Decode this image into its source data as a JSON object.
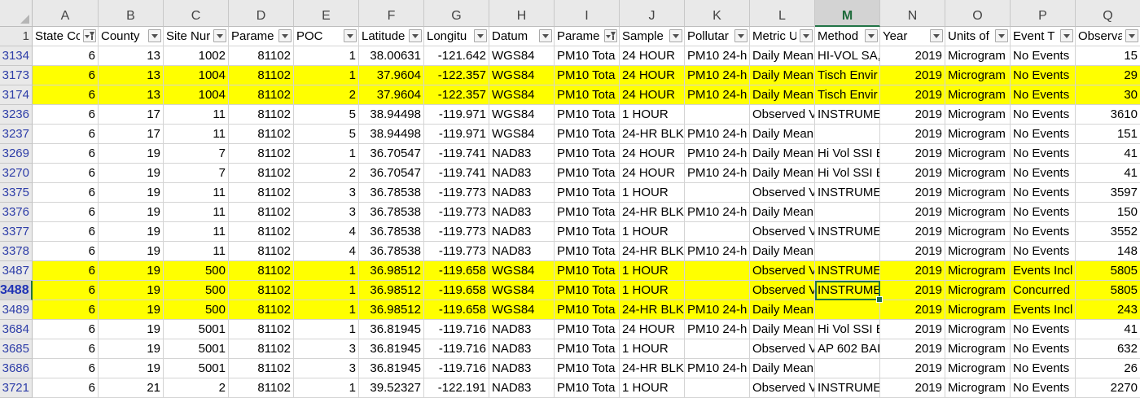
{
  "columns": [
    "A",
    "B",
    "C",
    "D",
    "E",
    "F",
    "G",
    "H",
    "I",
    "J",
    "K",
    "L",
    "M",
    "N",
    "O",
    "P",
    "Q"
  ],
  "selected_column": "M",
  "header_row_number": "1",
  "headers": [
    {
      "label": "State Co",
      "filter": "active"
    },
    {
      "label": "County",
      "filter": "dropdown"
    },
    {
      "label": "Site Nur",
      "filter": "dropdown"
    },
    {
      "label": "Parame",
      "filter": "dropdown"
    },
    {
      "label": "POC",
      "filter": "dropdown"
    },
    {
      "label": "Latitude",
      "filter": "dropdown"
    },
    {
      "label": "Longitu",
      "filter": "dropdown"
    },
    {
      "label": "Datum",
      "filter": "dropdown"
    },
    {
      "label": "Parame",
      "filter": "active"
    },
    {
      "label": "Sample",
      "filter": "dropdown"
    },
    {
      "label": "Pollutar",
      "filter": "dropdown"
    },
    {
      "label": "Metric U",
      "filter": "dropdown"
    },
    {
      "label": "Method",
      "filter": "dropdown"
    },
    {
      "label": "Year",
      "filter": "dropdown"
    },
    {
      "label": "Units of",
      "filter": "dropdown"
    },
    {
      "label": "Event T",
      "filter": "dropdown"
    },
    {
      "label": "Observa",
      "filter": "dropdown"
    }
  ],
  "rows": [
    {
      "num": "3134",
      "hl": false,
      "cells": [
        "6",
        "13",
        "1002",
        "81102",
        "1",
        "38.00631",
        "-121.642",
        "WGS84",
        "PM10 Tota",
        "24 HOUR",
        "PM10 24-h",
        "Daily Mean",
        "HI-VOL SA,",
        "2019",
        "Microgram",
        "No Events",
        "15"
      ]
    },
    {
      "num": "3173",
      "hl": true,
      "cells": [
        "6",
        "13",
        "1004",
        "81102",
        "1",
        "37.9604",
        "-122.357",
        "WGS84",
        "PM10 Tota",
        "24 HOUR",
        "PM10 24-h",
        "Daily Mean",
        "Tisch Envir",
        "2019",
        "Microgram",
        "No Events",
        "29"
      ]
    },
    {
      "num": "3174",
      "hl": true,
      "cells": [
        "6",
        "13",
        "1004",
        "81102",
        "2",
        "37.9604",
        "-122.357",
        "WGS84",
        "PM10 Tota",
        "24 HOUR",
        "PM10 24-h",
        "Daily Mean",
        "Tisch Envir",
        "2019",
        "Microgram",
        "No Events",
        "30"
      ]
    },
    {
      "num": "3236",
      "hl": false,
      "cells": [
        "6",
        "17",
        "11",
        "81102",
        "5",
        "38.94498",
        "-119.971",
        "WGS84",
        "PM10 Tota",
        "1 HOUR",
        "",
        "Observed V",
        "INSTRUMEN",
        "2019",
        "Microgram",
        "No Events",
        "3610"
      ]
    },
    {
      "num": "3237",
      "hl": false,
      "cells": [
        "6",
        "17",
        "11",
        "81102",
        "5",
        "38.94498",
        "-119.971",
        "WGS84",
        "PM10 Tota",
        "24-HR BLK",
        "PM10 24-h",
        "Daily Mean",
        "",
        "2019",
        "Microgram",
        "No Events",
        "151"
      ]
    },
    {
      "num": "3269",
      "hl": false,
      "cells": [
        "6",
        "19",
        "7",
        "81102",
        "1",
        "36.70547",
        "-119.741",
        "NAD83",
        "PM10 Tota",
        "24 HOUR",
        "PM10 24-h",
        "Daily Mean",
        "Hi Vol SSI E",
        "2019",
        "Microgram",
        "No Events",
        "41"
      ]
    },
    {
      "num": "3270",
      "hl": false,
      "cells": [
        "6",
        "19",
        "7",
        "81102",
        "2",
        "36.70547",
        "-119.741",
        "NAD83",
        "PM10 Tota",
        "24 HOUR",
        "PM10 24-h",
        "Daily Mean",
        "Hi Vol SSI E",
        "2019",
        "Microgram",
        "No Events",
        "41"
      ]
    },
    {
      "num": "3375",
      "hl": false,
      "cells": [
        "6",
        "19",
        "11",
        "81102",
        "3",
        "36.78538",
        "-119.773",
        "NAD83",
        "PM10 Tota",
        "1 HOUR",
        "",
        "Observed V",
        "INSTRUMEN",
        "2019",
        "Microgram",
        "No Events",
        "3597"
      ]
    },
    {
      "num": "3376",
      "hl": false,
      "cells": [
        "6",
        "19",
        "11",
        "81102",
        "3",
        "36.78538",
        "-119.773",
        "NAD83",
        "PM10 Tota",
        "24-HR BLK",
        "PM10 24-h",
        "Daily Mean",
        "",
        "2019",
        "Microgram",
        "No Events",
        "150"
      ]
    },
    {
      "num": "3377",
      "hl": false,
      "cells": [
        "6",
        "19",
        "11",
        "81102",
        "4",
        "36.78538",
        "-119.773",
        "NAD83",
        "PM10 Tota",
        "1 HOUR",
        "",
        "Observed V",
        "INSTRUMEN",
        "2019",
        "Microgram",
        "No Events",
        "3552"
      ]
    },
    {
      "num": "3378",
      "hl": false,
      "cells": [
        "6",
        "19",
        "11",
        "81102",
        "4",
        "36.78538",
        "-119.773",
        "NAD83",
        "PM10 Tota",
        "24-HR BLK",
        "PM10 24-h",
        "Daily Mean",
        "",
        "2019",
        "Microgram",
        "No Events",
        "148"
      ]
    },
    {
      "num": "3487",
      "hl": true,
      "cells": [
        "6",
        "19",
        "500",
        "81102",
        "1",
        "36.98512",
        "-119.658",
        "WGS84",
        "PM10 Tota",
        "1 HOUR",
        "",
        "Observed V",
        "INSTRUMEN",
        "2019",
        "Microgram",
        "Events Incl",
        "5805"
      ]
    },
    {
      "num": "3488",
      "hl": true,
      "active": true,
      "cells": [
        "6",
        "19",
        "500",
        "81102",
        "1",
        "36.98512",
        "-119.658",
        "WGS84",
        "PM10 Tota",
        "1 HOUR",
        "",
        "Observed V",
        "INSTRUMEN",
        "2019",
        "Microgram",
        "Concurred",
        "5805"
      ]
    },
    {
      "num": "3489",
      "hl": true,
      "cells": [
        "6",
        "19",
        "500",
        "81102",
        "1",
        "36.98512",
        "-119.658",
        "WGS84",
        "PM10 Tota",
        "24-HR BLK",
        "PM10 24-h",
        "Daily Mean",
        "",
        "2019",
        "Microgram",
        "Events Incl",
        "243"
      ]
    },
    {
      "num": "3684",
      "hl": false,
      "cells": [
        "6",
        "19",
        "5001",
        "81102",
        "1",
        "36.81945",
        "-119.716",
        "NAD83",
        "PM10 Tota",
        "24 HOUR",
        "PM10 24-h",
        "Daily Mean",
        "Hi Vol SSI E",
        "2019",
        "Microgram",
        "No Events",
        "41"
      ]
    },
    {
      "num": "3685",
      "hl": false,
      "cells": [
        "6",
        "19",
        "5001",
        "81102",
        "3",
        "36.81945",
        "-119.716",
        "NAD83",
        "PM10 Tota",
        "1 HOUR",
        "",
        "Observed V",
        "AP 602 BAI",
        "2019",
        "Microgram",
        "No Events",
        "632"
      ]
    },
    {
      "num": "3686",
      "hl": false,
      "cells": [
        "6",
        "19",
        "5001",
        "81102",
        "3",
        "36.81945",
        "-119.716",
        "NAD83",
        "PM10 Tota",
        "24-HR BLK",
        "PM10 24-h",
        "Daily Mean",
        "",
        "2019",
        "Microgram",
        "No Events",
        "26"
      ]
    },
    {
      "num": "3721",
      "hl": false,
      "cells": [
        "6",
        "21",
        "2",
        "81102",
        "1",
        "39.52327",
        "-122.191",
        "NAD83",
        "PM10 Tota",
        "1 HOUR",
        "",
        "Observed V",
        "INSTRUMEN",
        "2019",
        "Microgram",
        "No Events",
        "2270"
      ]
    }
  ],
  "numeric_columns": [
    0,
    1,
    2,
    3,
    4,
    5,
    6,
    13,
    16
  ],
  "active_cell": {
    "row": 12,
    "col": 12
  },
  "colors": {
    "highlight": "#ffff00",
    "selection": "#217346",
    "row_header_text": "#2e3ea8"
  }
}
